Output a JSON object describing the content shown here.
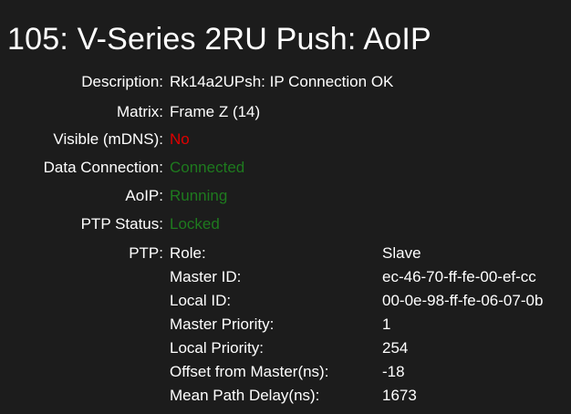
{
  "title": "105: V-Series 2RU Push: AoIP",
  "colors": {
    "background": "#1c1c1c",
    "text": "#ffffff",
    "error": "#e00000",
    "ok": "#1e7a1e"
  },
  "fields": {
    "description": {
      "label": "Description:",
      "value": "Rk14a2UPsh: IP Connection OK"
    },
    "matrix": {
      "label": "Matrix:",
      "value": "Frame Z (14)"
    },
    "visible_mdns": {
      "label": "Visible (mDNS):",
      "value": "No"
    },
    "data_connection": {
      "label": "Data Connection:",
      "value": "Connected"
    },
    "aoip": {
      "label": "AoIP:",
      "value": "Running"
    },
    "ptp_status": {
      "label": "PTP Status:",
      "value": "Locked"
    }
  },
  "ptp": {
    "label": "PTP:",
    "rows": [
      {
        "label": "Role:",
        "value": "Slave"
      },
      {
        "label": "Master ID:",
        "value": "ec-46-70-ff-fe-00-ef-cc"
      },
      {
        "label": "Local ID:",
        "value": "00-0e-98-ff-fe-06-07-0b"
      },
      {
        "label": "Master Priority:",
        "value": "1"
      },
      {
        "label": "Local Priority:",
        "value": "254"
      },
      {
        "label": "Offset from Master(ns):",
        "value": "-18"
      },
      {
        "label": "Mean Path Delay(ns):",
        "value": "1673"
      }
    ]
  }
}
